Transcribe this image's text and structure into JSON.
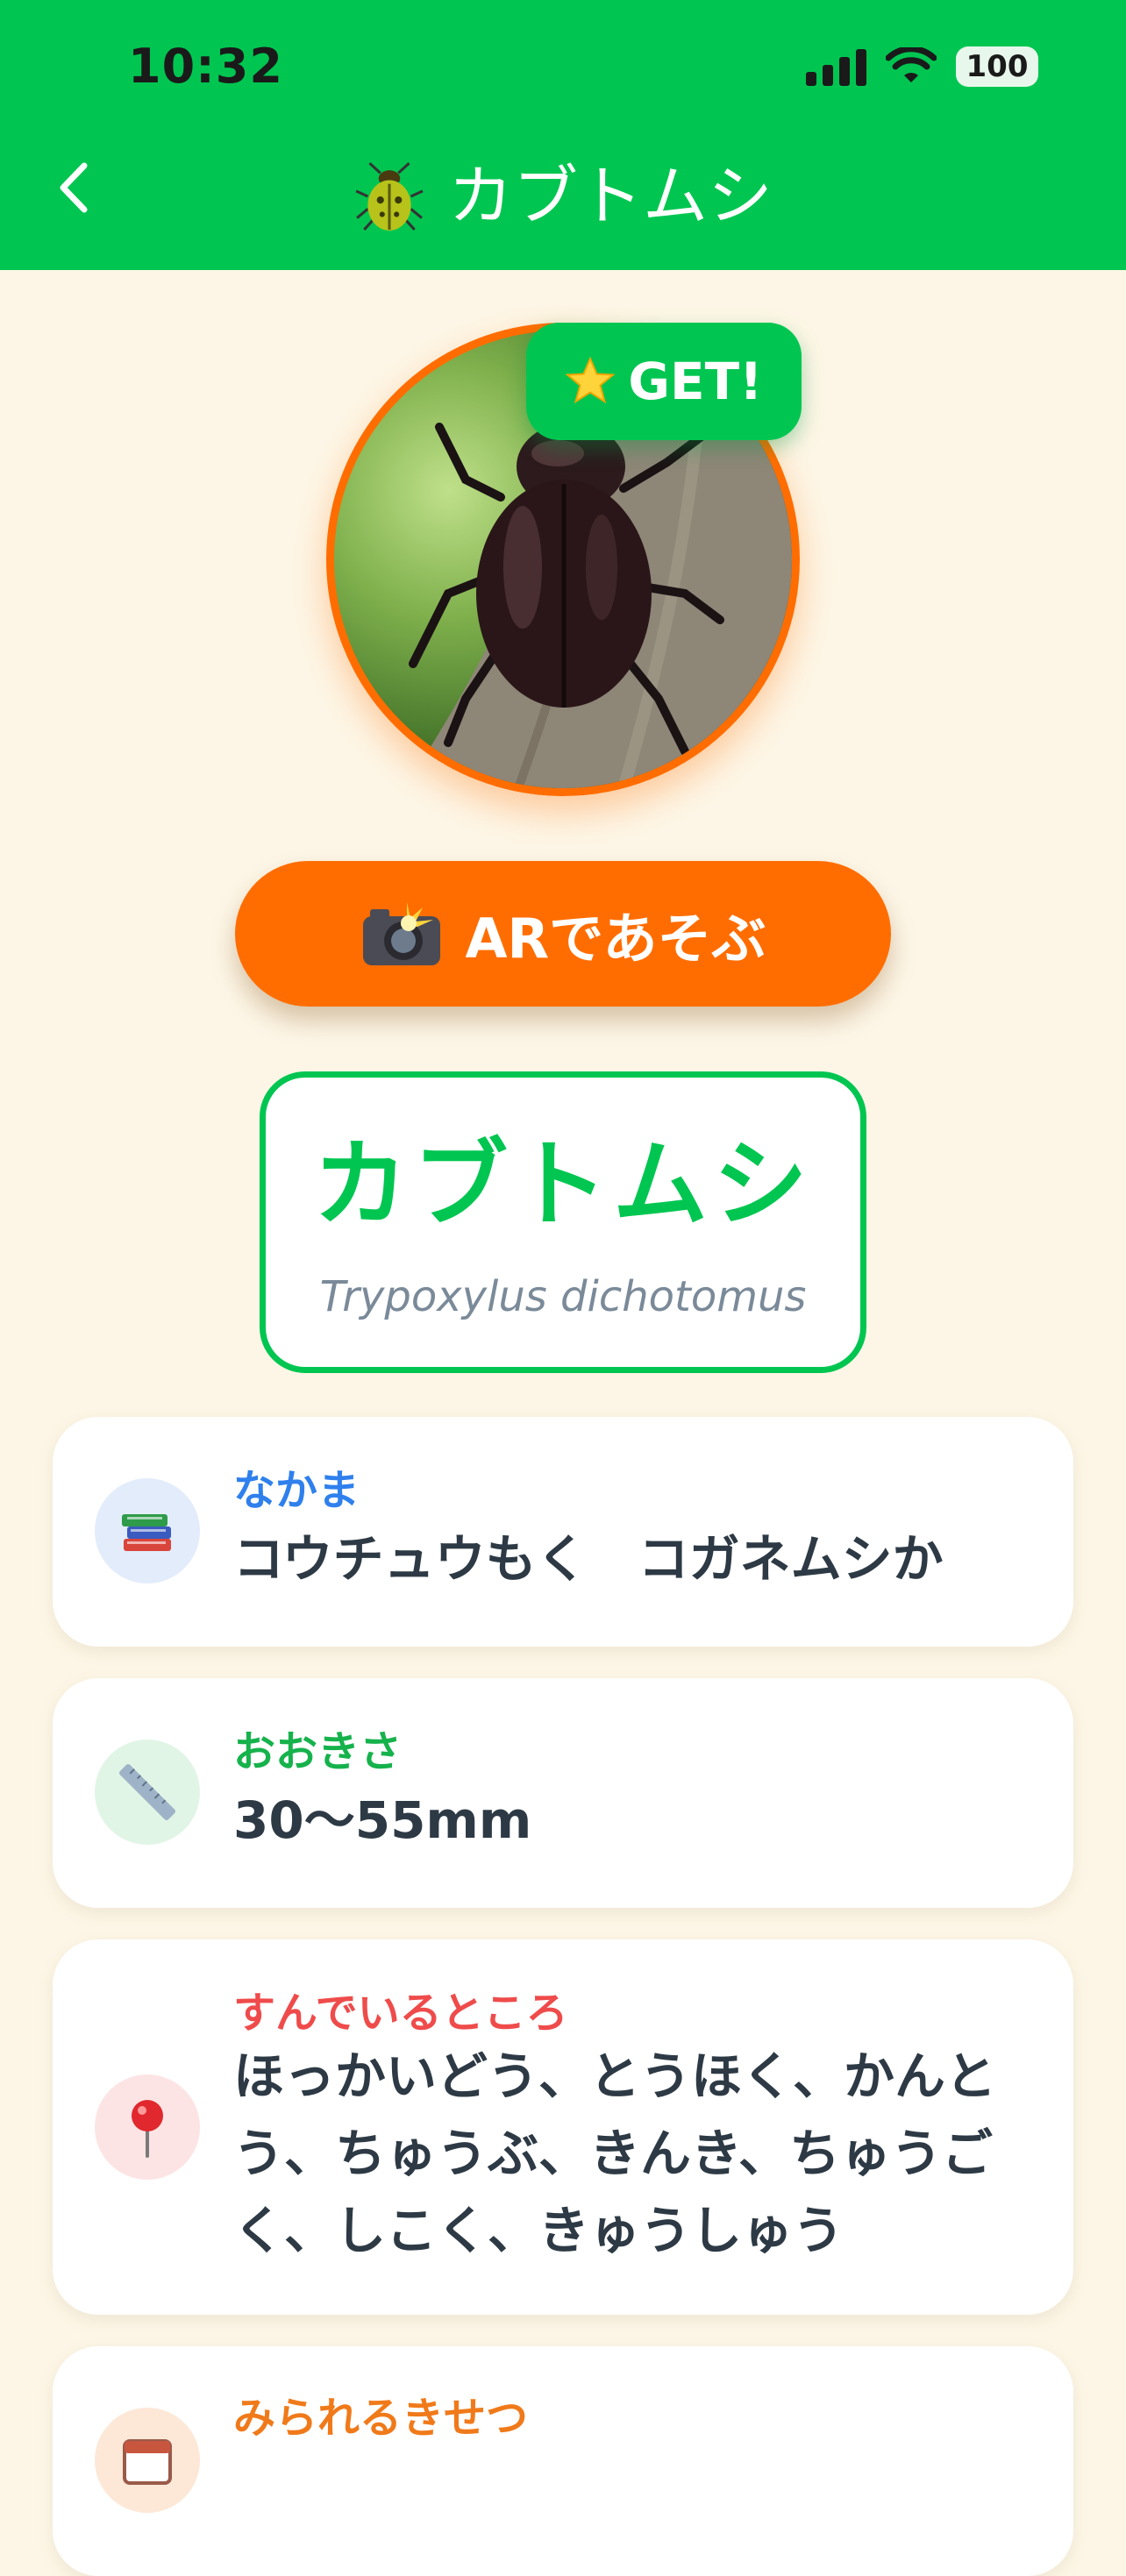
{
  "status_bar": {
    "time": "10:32",
    "battery": "100"
  },
  "nav": {
    "title": "カブトムシ",
    "title_icon": "beetle-icon",
    "back_icon": "chevron-left-icon"
  },
  "hero": {
    "badge": "GET!",
    "badge_icon": "star-icon"
  },
  "ar_button": {
    "label": "ARであそぶ",
    "icon": "camera-flash-icon"
  },
  "name_card": {
    "name": "カブトムシ",
    "scientific_name": "Trypoxylus dichotomus"
  },
  "info_cards": [
    {
      "label": "なかま",
      "value": "コウチュウもく　コガネムシか",
      "icon": "books-icon",
      "label_color": "#2f80ed",
      "icon_bg": "#e3ecfb"
    },
    {
      "label": "おおきさ",
      "value": "30〜55mm",
      "icon": "ruler-icon",
      "label_color": "#16b24c",
      "icon_bg": "#e1f5e6"
    },
    {
      "label": "すんでいるところ",
      "value": "ほっかいどう、とうほく、かんとう、ちゅうぶ、きんき、ちゅうごく、しこく、きゅうしゅう",
      "icon": "pushpin-icon",
      "label_color": "#ef4b4b",
      "icon_bg": "#fde4e4"
    },
    {
      "label": "みられるきせつ",
      "icon": "calendar-icon",
      "label_color": "#f07a1a",
      "icon_bg": "#fde8d8"
    }
  ],
  "colors": {
    "primary_green": "#00c651",
    "accent_orange": "#ff6d00",
    "background": "#fdf6e6"
  }
}
